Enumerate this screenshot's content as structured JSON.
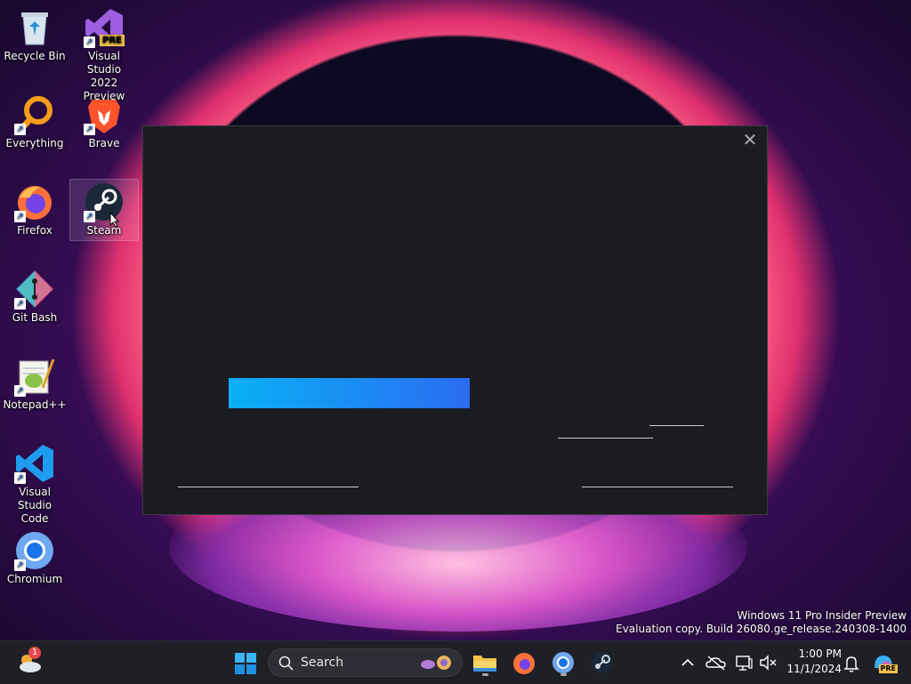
{
  "desktop": {
    "icons": [
      {
        "label": "Recycle Bin"
      },
      {
        "label": "Visual Studio\n2022 Preview",
        "badge": "PRE"
      },
      {
        "label": "Everything"
      },
      {
        "label": "Brave"
      },
      {
        "label": "Firefox"
      },
      {
        "label": "Steam"
      },
      {
        "label": "Git Bash"
      },
      {
        "label": "Notepad++"
      },
      {
        "label": "Visual Studio\nCode"
      },
      {
        "label": "Chromium"
      }
    ]
  },
  "dialog": {
    "close_glyph": "✕",
    "accent_gradient": [
      "#0ab0f5",
      "#2a6cf0"
    ]
  },
  "watermark": {
    "line1": "Windows 11 Pro Insider Preview",
    "line2": "Evaluation copy. Build 26080.ge_release.240308-1400"
  },
  "taskbar": {
    "search_label": "Search",
    "time": "1:00 PM",
    "date": "11/1/2024",
    "weather_badge": "1",
    "copilot_badge": "PRE"
  }
}
